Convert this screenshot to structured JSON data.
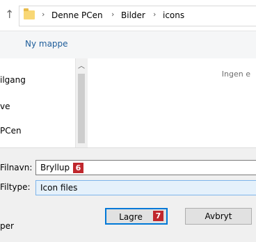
{
  "address": {
    "breadcrumb": [
      "Denne PCen",
      "Bilder",
      "icons"
    ]
  },
  "toolbar": {
    "new_folder_label": "Ny mappe"
  },
  "nav": {
    "items": [
      "ilgang",
      "ve",
      "PCen"
    ]
  },
  "content": {
    "empty_text": "Ingen e"
  },
  "form": {
    "filename_label": "Filnavn:",
    "filename_value": "Bryllup",
    "filename_badge": "6",
    "filetype_label": "Filtype:",
    "filetype_value": "Icon files",
    "save_label": "Lagre",
    "save_badge": "7",
    "cancel_label": "Avbryt",
    "bottom_left_text": "per"
  }
}
